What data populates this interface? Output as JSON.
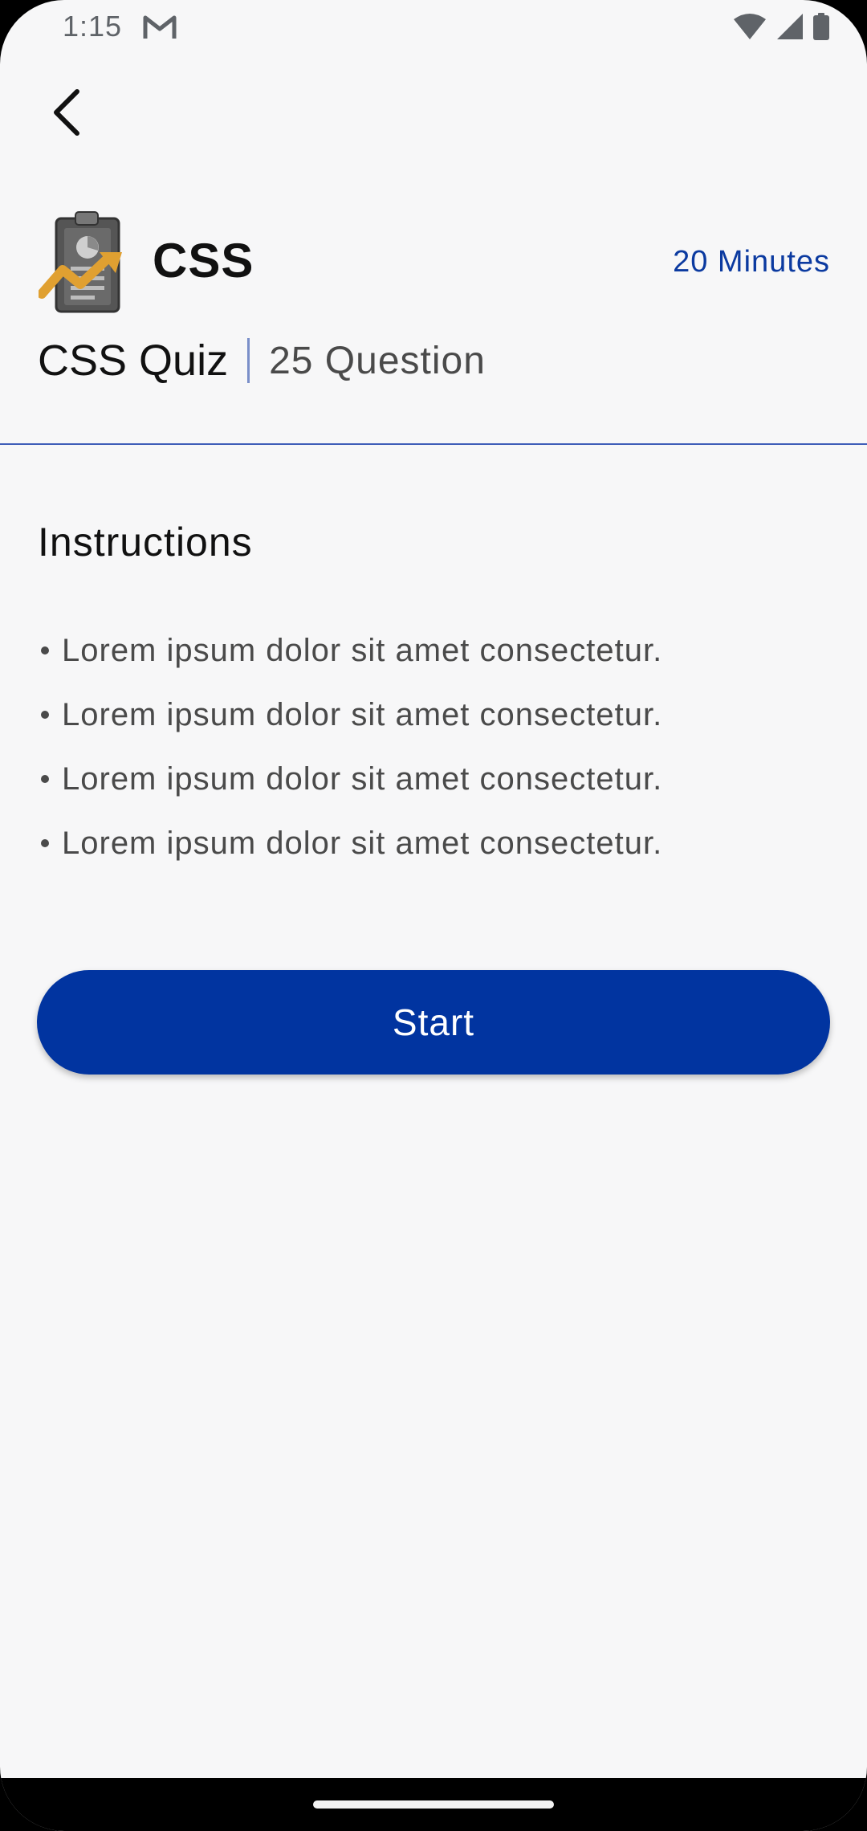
{
  "status_bar": {
    "time": "1:15",
    "icons": [
      "gmail-icon",
      "wifi-icon",
      "signal-icon",
      "battery-icon"
    ]
  },
  "header": {
    "back_icon": "back-arrow-icon",
    "subject": "CSS",
    "duration": "20 Minutes",
    "quiz_name": "CSS Quiz",
    "question_count": "25 Question",
    "logo_icon": "quiz-report-icon"
  },
  "instructions": {
    "title": "Instructions",
    "items": [
      "Lorem ipsum dolor sit amet consectetur.",
      "Lorem ipsum dolor sit amet consectetur.",
      "Lorem ipsum dolor sit amet consectetur.",
      "Lorem ipsum dolor sit amet consectetur."
    ]
  },
  "actions": {
    "start_label": "Start"
  },
  "colors": {
    "accent": "#0134a0",
    "duration_text": "#0b3aa0",
    "divider": "#3f5eb8",
    "background": "#f7f7f8"
  }
}
